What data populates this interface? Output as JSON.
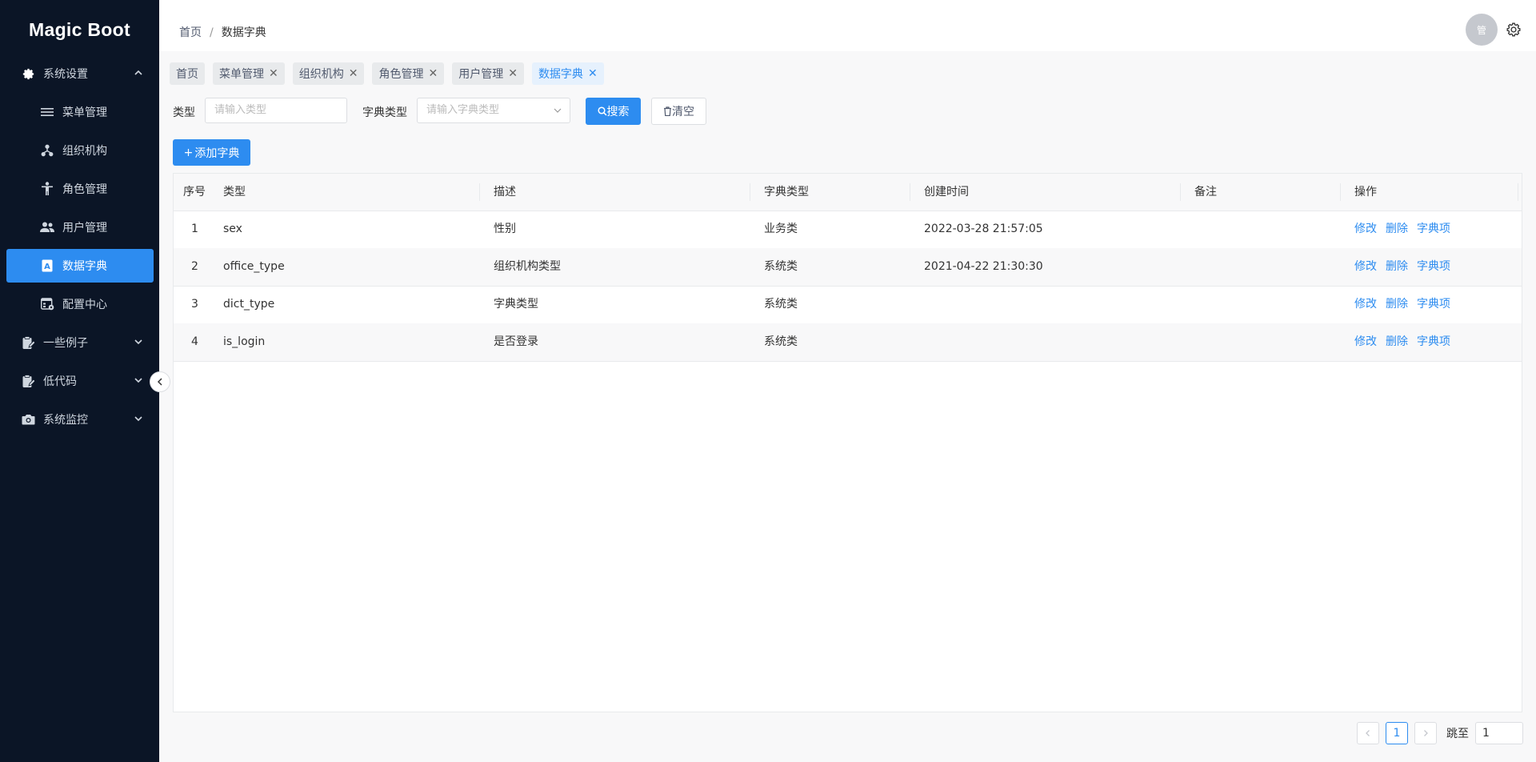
{
  "app": {
    "title": "Magic Boot"
  },
  "sidebar": {
    "groups": [
      {
        "label": "系统设置",
        "icon": "gear-icon",
        "expanded": true
      },
      {
        "label": "一些例子",
        "icon": "clipboard-icon",
        "expanded": false
      },
      {
        "label": "低代码",
        "icon": "clipboard-icon",
        "expanded": false
      },
      {
        "label": "系统监控",
        "icon": "camera-icon",
        "expanded": false
      }
    ],
    "items": [
      {
        "label": "菜单管理",
        "icon": "list-icon"
      },
      {
        "label": "组织机构",
        "icon": "org-tree-icon"
      },
      {
        "label": "角色管理",
        "icon": "person-icon"
      },
      {
        "label": "用户管理",
        "icon": "people-icon"
      },
      {
        "label": "数据字典",
        "icon": "dictionary-icon",
        "active": true
      },
      {
        "label": "配置中心",
        "icon": "config-icon"
      }
    ]
  },
  "header": {
    "breadcrumb": [
      "首页",
      "/",
      "数据字典"
    ],
    "avatar_text": "管"
  },
  "tabs": [
    {
      "label": "首页",
      "closable": false
    },
    {
      "label": "菜单管理",
      "closable": true
    },
    {
      "label": "组织机构",
      "closable": true
    },
    {
      "label": "角色管理",
      "closable": true
    },
    {
      "label": "用户管理",
      "closable": true
    },
    {
      "label": "数据字典",
      "closable": true,
      "active": true
    }
  ],
  "search": {
    "type_label": "类型",
    "type_placeholder": "请输入类型",
    "dict_type_label": "字典类型",
    "dict_type_placeholder": "请输入字典类型",
    "search_button": "搜索",
    "clear_button": "清空"
  },
  "toolbar": {
    "add_button": "添加字典"
  },
  "table": {
    "columns": [
      "序号",
      "类型",
      "描述",
      "字典类型",
      "创建时间",
      "备注",
      "操作"
    ],
    "rows": [
      {
        "index": "1",
        "type": "sex",
        "desc": "性别",
        "dict_type": "业务类",
        "created": "2022-03-28 21:57:05",
        "remark": ""
      },
      {
        "index": "2",
        "type": "office_type",
        "desc": "组织机构类型",
        "dict_type": "系统类",
        "created": "2021-04-22 21:30:30",
        "remark": ""
      },
      {
        "index": "3",
        "type": "dict_type",
        "desc": "字典类型",
        "dict_type": "系统类",
        "created": "",
        "remark": ""
      },
      {
        "index": "4",
        "type": "is_login",
        "desc": "是否登录",
        "dict_type": "系统类",
        "created": "",
        "remark": ""
      }
    ],
    "actions": [
      "修改",
      "删除",
      "字典项"
    ]
  },
  "pagination": {
    "current_page": "1",
    "jump_label": "跳至",
    "jump_value": "1"
  },
  "colors": {
    "sidebar_bg": "#0b1526",
    "accent": "#2d8cf0"
  }
}
